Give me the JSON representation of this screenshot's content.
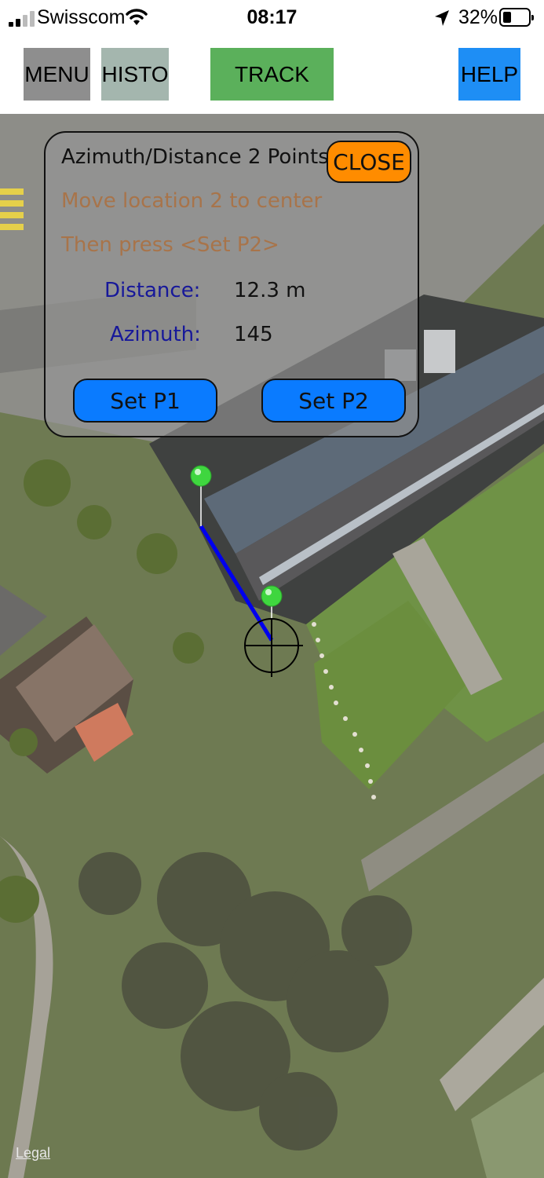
{
  "status_bar": {
    "carrier": "Swisscom",
    "time": "08:17",
    "battery_percent": "32%",
    "battery_level": 0.32,
    "icons": [
      "signal-icon",
      "wifi-icon",
      "location-arrow-icon",
      "battery-icon"
    ]
  },
  "toolbar": {
    "menu_label": "MENU",
    "histo_label": "HISTO",
    "track_label": "TRACK",
    "help_label": "HELP",
    "colors": {
      "menu": "#8e8e8e",
      "histo": "#a4b6ae",
      "track": "#5bb05b",
      "help": "#1e8ef5"
    }
  },
  "panel": {
    "title": "Azimuth/Distance 2 Points",
    "close_label": "CLOSE",
    "instruction_1": "Move location 2 to center",
    "instruction_2": "Then press <Set P2>",
    "distance_label": "Distance:",
    "distance_value": "12.3 m",
    "azimuth_label": "Azimuth:",
    "azimuth_value": "145",
    "set_p1_label": "Set P1",
    "set_p2_label": "Set P2",
    "colors": {
      "close": "#ff8c00",
      "set_buttons": "#0a7bff",
      "labels": "#17189a",
      "instructions": "#a8744a"
    }
  },
  "map": {
    "markers": [
      "point-1-marker",
      "point-2-marker"
    ],
    "line_color": "#0000ee",
    "crosshair": "crosshair-icon",
    "legal_label": "Legal"
  }
}
